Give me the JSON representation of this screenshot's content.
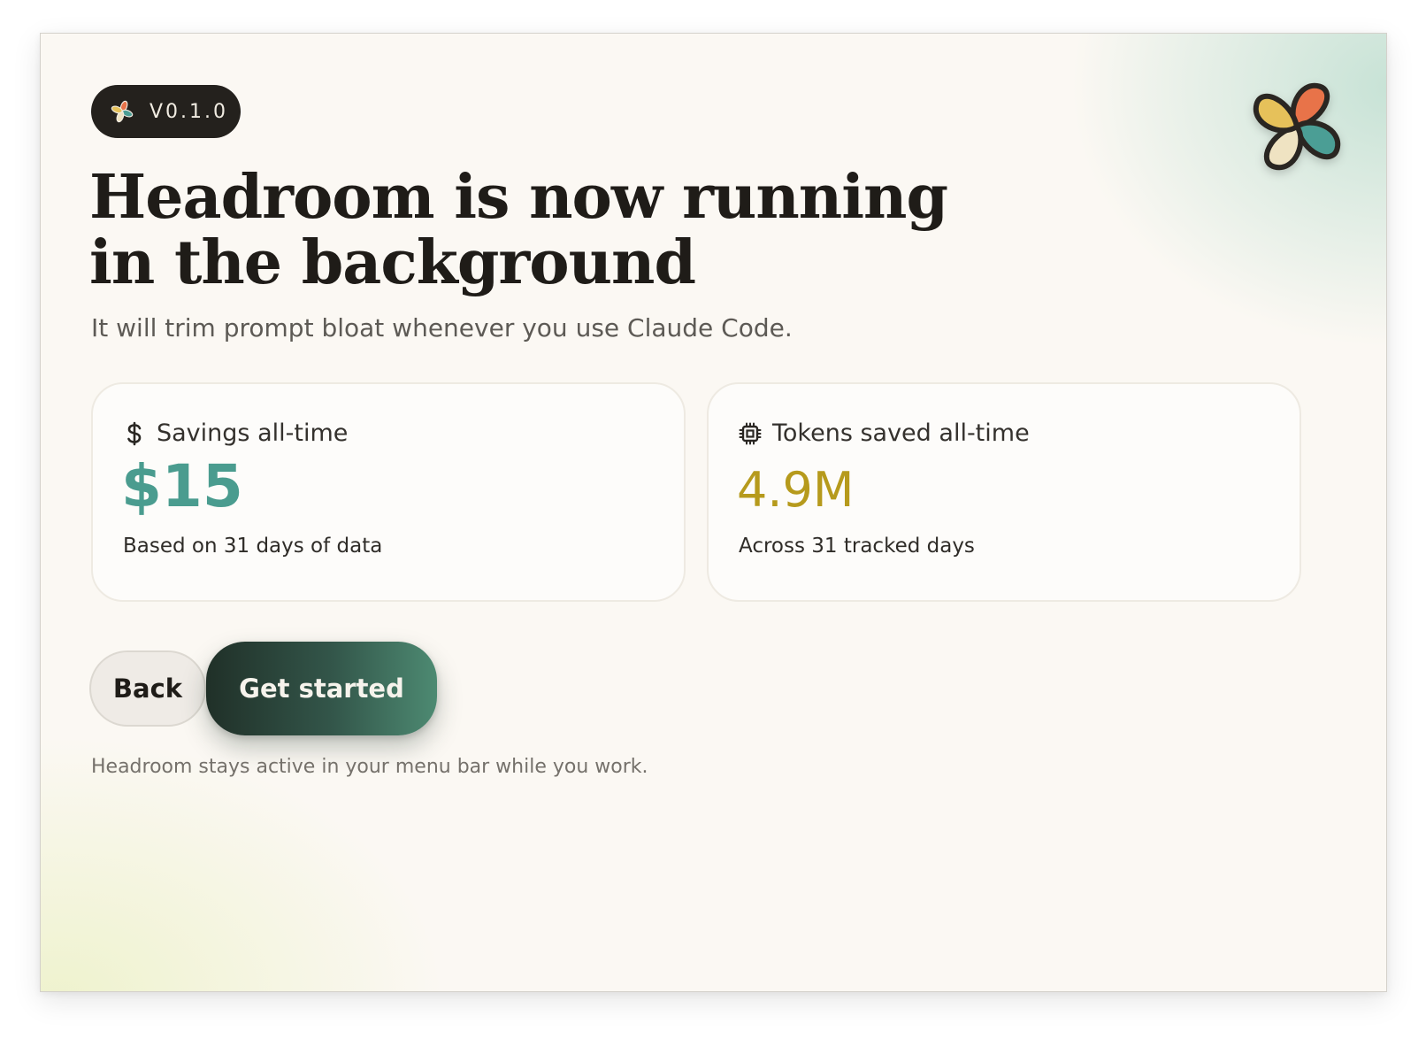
{
  "version_badge": {
    "label": "V0.1.0",
    "icon": "pinwheel-logo-icon"
  },
  "app_logo": {
    "icon": "pinwheel-logo-icon",
    "colors": [
      "#e8734a",
      "#4c9e95",
      "#e6c15a",
      "#efe3c2"
    ]
  },
  "heading": {
    "line1": "Headroom is now running",
    "line2": "in the background"
  },
  "subtitle": "It will trim prompt bloat whenever you use Claude Code.",
  "cards": {
    "savings": {
      "icon": "dollar-icon",
      "label": "Savings all-time",
      "value": "$15",
      "note": "Based on 31 days of data",
      "value_color": "#4a9c8f"
    },
    "tokens": {
      "icon": "chip-icon",
      "label": "Tokens saved all-time",
      "value": "4.9M",
      "note": "Across 31 tracked days",
      "value_color": "#b69a1c"
    }
  },
  "actions": {
    "back_label": "Back",
    "primary_label": "Get started"
  },
  "footnote": "Headroom stays active in your menu bar while you work."
}
